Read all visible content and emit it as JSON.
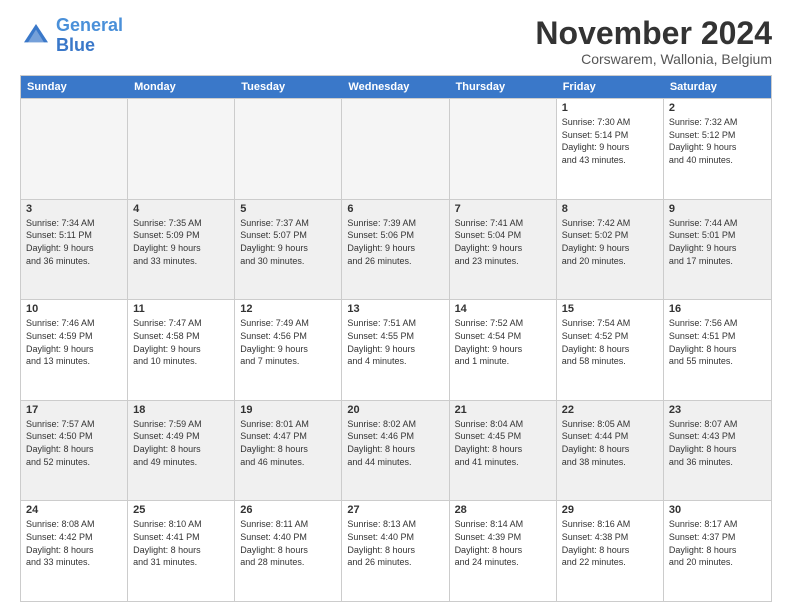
{
  "logo": {
    "line1": "General",
    "line2": "Blue"
  },
  "title": "November 2024",
  "subtitle": "Corswarem, Wallonia, Belgium",
  "header_days": [
    "Sunday",
    "Monday",
    "Tuesday",
    "Wednesday",
    "Thursday",
    "Friday",
    "Saturday"
  ],
  "rows": [
    [
      {
        "day": "",
        "info": "",
        "empty": true
      },
      {
        "day": "",
        "info": "",
        "empty": true
      },
      {
        "day": "",
        "info": "",
        "empty": true
      },
      {
        "day": "",
        "info": "",
        "empty": true
      },
      {
        "day": "",
        "info": "",
        "empty": true
      },
      {
        "day": "1",
        "info": "Sunrise: 7:30 AM\nSunset: 5:14 PM\nDaylight: 9 hours\nand 43 minutes."
      },
      {
        "day": "2",
        "info": "Sunrise: 7:32 AM\nSunset: 5:12 PM\nDaylight: 9 hours\nand 40 minutes."
      }
    ],
    [
      {
        "day": "3",
        "info": "Sunrise: 7:34 AM\nSunset: 5:11 PM\nDaylight: 9 hours\nand 36 minutes."
      },
      {
        "day": "4",
        "info": "Sunrise: 7:35 AM\nSunset: 5:09 PM\nDaylight: 9 hours\nand 33 minutes."
      },
      {
        "day": "5",
        "info": "Sunrise: 7:37 AM\nSunset: 5:07 PM\nDaylight: 9 hours\nand 30 minutes."
      },
      {
        "day": "6",
        "info": "Sunrise: 7:39 AM\nSunset: 5:06 PM\nDaylight: 9 hours\nand 26 minutes."
      },
      {
        "day": "7",
        "info": "Sunrise: 7:41 AM\nSunset: 5:04 PM\nDaylight: 9 hours\nand 23 minutes."
      },
      {
        "day": "8",
        "info": "Sunrise: 7:42 AM\nSunset: 5:02 PM\nDaylight: 9 hours\nand 20 minutes."
      },
      {
        "day": "9",
        "info": "Sunrise: 7:44 AM\nSunset: 5:01 PM\nDaylight: 9 hours\nand 17 minutes."
      }
    ],
    [
      {
        "day": "10",
        "info": "Sunrise: 7:46 AM\nSunset: 4:59 PM\nDaylight: 9 hours\nand 13 minutes."
      },
      {
        "day": "11",
        "info": "Sunrise: 7:47 AM\nSunset: 4:58 PM\nDaylight: 9 hours\nand 10 minutes."
      },
      {
        "day": "12",
        "info": "Sunrise: 7:49 AM\nSunset: 4:56 PM\nDaylight: 9 hours\nand 7 minutes."
      },
      {
        "day": "13",
        "info": "Sunrise: 7:51 AM\nSunset: 4:55 PM\nDaylight: 9 hours\nand 4 minutes."
      },
      {
        "day": "14",
        "info": "Sunrise: 7:52 AM\nSunset: 4:54 PM\nDaylight: 9 hours\nand 1 minute."
      },
      {
        "day": "15",
        "info": "Sunrise: 7:54 AM\nSunset: 4:52 PM\nDaylight: 8 hours\nand 58 minutes."
      },
      {
        "day": "16",
        "info": "Sunrise: 7:56 AM\nSunset: 4:51 PM\nDaylight: 8 hours\nand 55 minutes."
      }
    ],
    [
      {
        "day": "17",
        "info": "Sunrise: 7:57 AM\nSunset: 4:50 PM\nDaylight: 8 hours\nand 52 minutes."
      },
      {
        "day": "18",
        "info": "Sunrise: 7:59 AM\nSunset: 4:49 PM\nDaylight: 8 hours\nand 49 minutes."
      },
      {
        "day": "19",
        "info": "Sunrise: 8:01 AM\nSunset: 4:47 PM\nDaylight: 8 hours\nand 46 minutes."
      },
      {
        "day": "20",
        "info": "Sunrise: 8:02 AM\nSunset: 4:46 PM\nDaylight: 8 hours\nand 44 minutes."
      },
      {
        "day": "21",
        "info": "Sunrise: 8:04 AM\nSunset: 4:45 PM\nDaylight: 8 hours\nand 41 minutes."
      },
      {
        "day": "22",
        "info": "Sunrise: 8:05 AM\nSunset: 4:44 PM\nDaylight: 8 hours\nand 38 minutes."
      },
      {
        "day": "23",
        "info": "Sunrise: 8:07 AM\nSunset: 4:43 PM\nDaylight: 8 hours\nand 36 minutes."
      }
    ],
    [
      {
        "day": "24",
        "info": "Sunrise: 8:08 AM\nSunset: 4:42 PM\nDaylight: 8 hours\nand 33 minutes."
      },
      {
        "day": "25",
        "info": "Sunrise: 8:10 AM\nSunset: 4:41 PM\nDaylight: 8 hours\nand 31 minutes."
      },
      {
        "day": "26",
        "info": "Sunrise: 8:11 AM\nSunset: 4:40 PM\nDaylight: 8 hours\nand 28 minutes."
      },
      {
        "day": "27",
        "info": "Sunrise: 8:13 AM\nSunset: 4:40 PM\nDaylight: 8 hours\nand 26 minutes."
      },
      {
        "day": "28",
        "info": "Sunrise: 8:14 AM\nSunset: 4:39 PM\nDaylight: 8 hours\nand 24 minutes."
      },
      {
        "day": "29",
        "info": "Sunrise: 8:16 AM\nSunset: 4:38 PM\nDaylight: 8 hours\nand 22 minutes."
      },
      {
        "day": "30",
        "info": "Sunrise: 8:17 AM\nSunset: 4:37 PM\nDaylight: 8 hours\nand 20 minutes."
      }
    ]
  ]
}
